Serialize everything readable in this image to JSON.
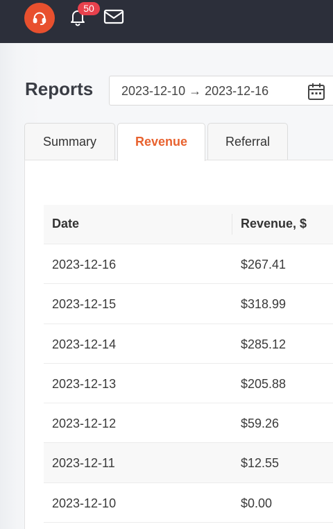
{
  "topbar": {
    "notification_count": "50",
    "accent_color": "#e8502e",
    "icons": [
      "headset-icon",
      "bell-icon",
      "mail-icon"
    ]
  },
  "page": {
    "title": "Reports"
  },
  "date_range": {
    "value": "2023-12-10 → 2023-12-16",
    "icon": "calendar-icon"
  },
  "tabs": [
    {
      "label": "Summary",
      "active": false
    },
    {
      "label": "Revenue",
      "active": true
    },
    {
      "label": "Referral",
      "active": false
    }
  ],
  "table": {
    "columns": [
      "Date",
      "Revenue, $"
    ],
    "rows": [
      {
        "date": "2023-12-16",
        "revenue": "$267.41"
      },
      {
        "date": "2023-12-15",
        "revenue": "$318.99"
      },
      {
        "date": "2023-12-14",
        "revenue": "$285.12"
      },
      {
        "date": "2023-12-13",
        "revenue": "$205.88"
      },
      {
        "date": "2023-12-12",
        "revenue": "$59.26"
      },
      {
        "date": "2023-12-11",
        "revenue": "$12.55"
      },
      {
        "date": "2023-12-10",
        "revenue": "$0.00"
      }
    ]
  }
}
